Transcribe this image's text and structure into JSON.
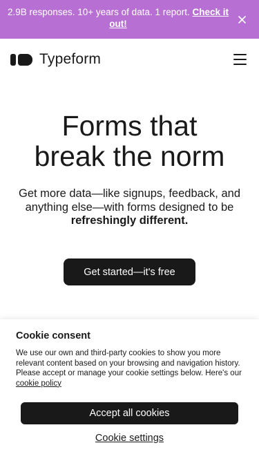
{
  "banner": {
    "text": "2.9B responses. 10+ years of data. 1 report.",
    "link_label": "Check it out!",
    "close_icon": "close-icon",
    "background": "#b86fd3"
  },
  "header": {
    "logo_text": "Typeform",
    "menu_icon": "hamburger-menu-icon"
  },
  "hero": {
    "title_line1": "Forms that",
    "title_line2": "break the norm",
    "subtitle": "Get more data—like signups, feedback, and anything else—with forms designed to be",
    "subtitle_bold": "refreshingly different.",
    "cta_label": "Get started—it's free"
  },
  "cookie": {
    "title": "Cookie consent",
    "text": "We use our own and third-party cookies to show you more relevant content based on your browsing and navigation history. Please accept or manage your cookie settings below. Here's our",
    "policy_link": "cookie policy",
    "accept_label": "Accept all cookies",
    "settings_label": "Cookie settings"
  },
  "colors": {
    "text": "#191919",
    "button": "#191919",
    "banner": "#b86fd3"
  }
}
